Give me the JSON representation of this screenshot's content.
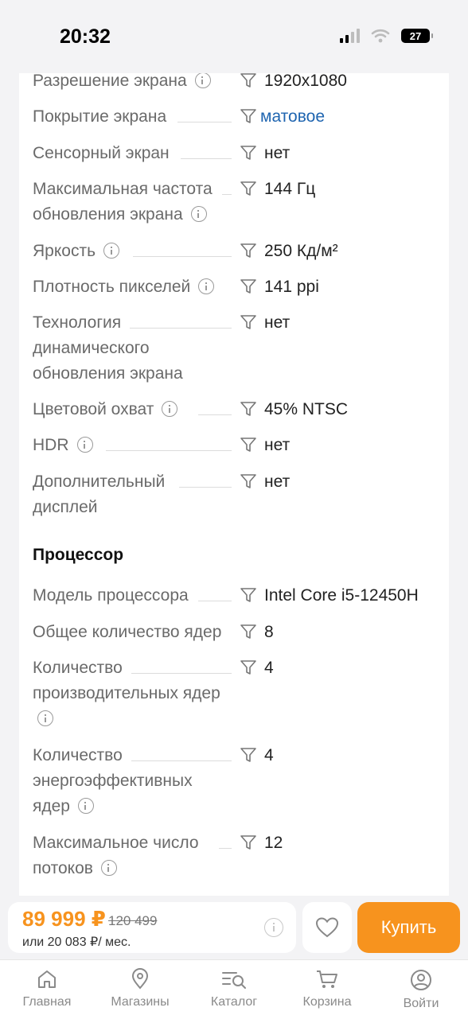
{
  "status_bar": {
    "time": "20:32",
    "battery": "27"
  },
  "specs_display": [
    {
      "name": "Разрешение экрана",
      "info": true,
      "value": "1920x1080",
      "link": false
    },
    {
      "name": "Покрытие экрана",
      "info": false,
      "value": "матовое",
      "link": true
    },
    {
      "name": "Сенсорный экран",
      "info": false,
      "value": "нет",
      "link": false
    },
    {
      "name": "Максимальная частота обновления экрана",
      "info": true,
      "value": "144 Гц",
      "link": false
    },
    {
      "name": "Яркость",
      "info": true,
      "value": "250 Кд/м²",
      "link": false
    },
    {
      "name": "Плотность пикселей",
      "info": true,
      "value": "141 ppi",
      "link": false
    },
    {
      "name": "Технология динамического обновления экрана",
      "info": false,
      "value": "нет",
      "link": false
    },
    {
      "name": "Цветовой охват",
      "info": true,
      "value": "45% NTSC",
      "link": false
    },
    {
      "name": "HDR",
      "info": true,
      "value": "нет",
      "link": false
    },
    {
      "name": "Дополнительный дисплей",
      "info": false,
      "value": "нет",
      "link": false
    }
  ],
  "section_cpu": {
    "title": "Процессор"
  },
  "specs_cpu": [
    {
      "name": "Модель процессора",
      "info": false,
      "value": "Intel Core i5-12450H",
      "link": false
    },
    {
      "name": "Общее количество ядер",
      "info": false,
      "value": "8",
      "link": false
    },
    {
      "name": "Количество производительных ядер",
      "info": true,
      "value": "4",
      "link": false
    },
    {
      "name": "Количество энергоэффективных ядер",
      "info": true,
      "value": "4",
      "link": false
    },
    {
      "name": "Максимальное число потоков",
      "info": true,
      "value": "12",
      "link": false
    }
  ],
  "purchase": {
    "price": "89 999 ₽",
    "old_price": "120 499",
    "monthly": "или 20 083 ₽/ мес.",
    "buy_label": "Купить"
  },
  "tabbar": {
    "home": "Главная",
    "stores": "Магазины",
    "catalog": "Каталог",
    "cart": "Корзина",
    "login": "Войти"
  },
  "colors": {
    "accent": "#f7931e",
    "link": "#1f65b0"
  }
}
